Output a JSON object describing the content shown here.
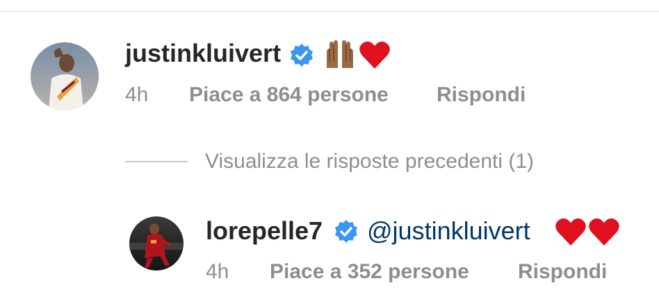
{
  "comments": [
    {
      "username": "justinkluivert",
      "verified": true,
      "emoji": [
        "raising-hands-brown",
        "red-heart"
      ],
      "time": "4h",
      "likes": "Piace a 864 persone",
      "reply": "Rispondi"
    },
    {
      "username": "lorepelle7",
      "verified": true,
      "mention": "@justinkluivert",
      "emoji": [
        "red-heart",
        "red-heart"
      ],
      "time": "4h",
      "likes": "Piace a 352 persone",
      "reply": "Rispondi"
    }
  ],
  "view_previous_replies": "Visualizza le risposte precedenti (1)",
  "colors": {
    "verified_badge": "#3897f0",
    "mention": "#00376b",
    "secondary_text": "#8e8e8e",
    "primary_text": "#262626",
    "heart": "#e0111f"
  }
}
